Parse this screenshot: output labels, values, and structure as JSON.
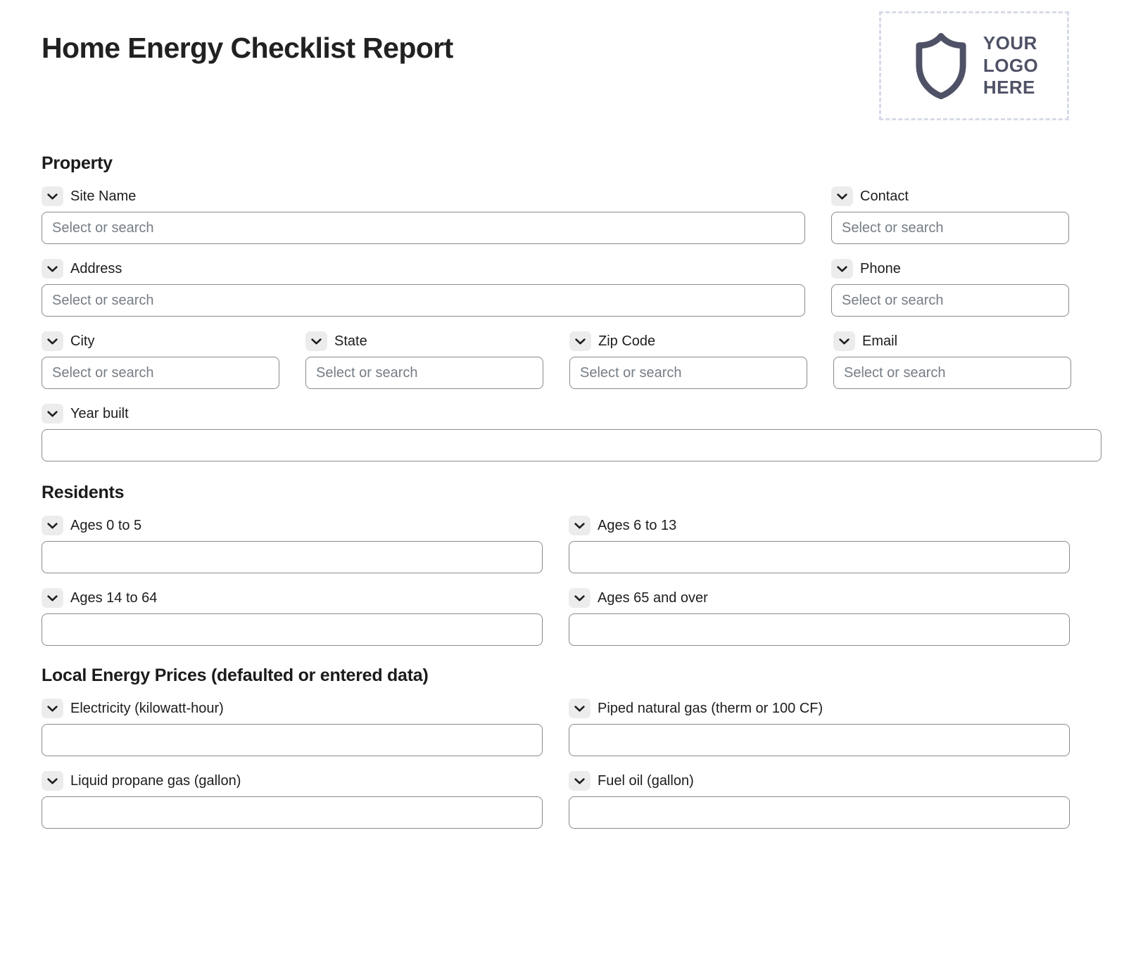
{
  "header": {
    "title": "Home Energy Checklist Report",
    "logo": {
      "line1": "YOUR",
      "line2": "LOGO",
      "line3": "HERE",
      "icon": "shield-icon",
      "border_color": "#d7dbe8",
      "text_color": "#4f5266"
    }
  },
  "common": {
    "select_placeholder": "Select or search",
    "empty_placeholder": "",
    "chevron_icon": "chevron-down-icon",
    "chevron_bg": "#ececec",
    "input_border": "#8a8a8a",
    "placeholder_color": "#767d85"
  },
  "sections": [
    {
      "title": "Property",
      "rows": [
        [
          {
            "label": "Site Name",
            "placeholder": "Select or search",
            "value": "",
            "width": "main"
          },
          {
            "label": "Contact",
            "placeholder": "Select or search",
            "value": "",
            "width": "side"
          }
        ],
        [
          {
            "label": "Address",
            "placeholder": "Select or search",
            "value": "",
            "width": "main"
          },
          {
            "label": "Phone",
            "placeholder": "Select or search",
            "value": "",
            "width": "side"
          }
        ],
        [
          {
            "label": "City",
            "placeholder": "Select or search",
            "value": "",
            "width": "quarter"
          },
          {
            "label": "State",
            "placeholder": "Select or search",
            "value": "",
            "width": "quarter"
          },
          {
            "label": "Zip Code",
            "placeholder": "Select or search",
            "value": "",
            "width": "quarter"
          },
          {
            "label": "Email",
            "placeholder": "Select or search",
            "value": "",
            "width": "quarter"
          }
        ],
        [
          {
            "label": "Year built",
            "placeholder": "",
            "value": "",
            "width": "full"
          }
        ]
      ]
    },
    {
      "title": "Residents",
      "rows": [
        [
          {
            "label": "Ages 0 to 5",
            "placeholder": "",
            "value": "",
            "width": "half"
          },
          {
            "label": "Ages 6 to 13",
            "placeholder": "",
            "value": "",
            "width": "half"
          }
        ],
        [
          {
            "label": "Ages 14 to 64",
            "placeholder": "",
            "value": "",
            "width": "half"
          },
          {
            "label": "Ages 65 and over",
            "placeholder": "",
            "value": "",
            "width": "half"
          }
        ]
      ]
    },
    {
      "title": "Local Energy Prices (defaulted or entered data)",
      "rows": [
        [
          {
            "label": "Electricity (kilowatt-hour)",
            "placeholder": "",
            "value": "",
            "width": "half"
          },
          {
            "label": "Piped natural gas (therm or 100 CF)",
            "placeholder": "",
            "value": "",
            "width": "half"
          }
        ],
        [
          {
            "label": "Liquid propane gas (gallon)",
            "placeholder": "",
            "value": "",
            "width": "half"
          },
          {
            "label": "Fuel oil (gallon)",
            "placeholder": "",
            "value": "",
            "width": "half"
          }
        ]
      ]
    }
  ]
}
